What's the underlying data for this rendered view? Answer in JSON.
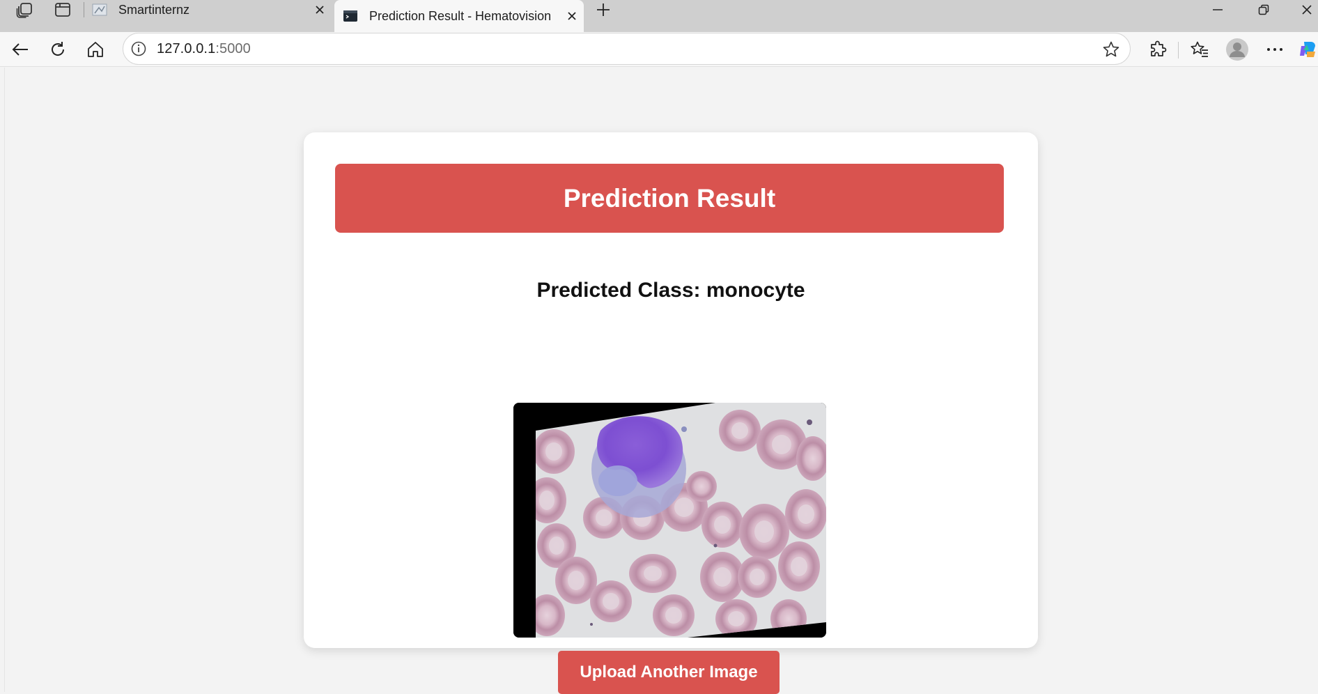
{
  "browser": {
    "tabs": [
      {
        "title": "Smartinternz",
        "active": false,
        "favicon": "page-favicon"
      },
      {
        "title": "Prediction Result - Hematovision",
        "active": true,
        "favicon": "terminal-favicon"
      }
    ],
    "address": {
      "host": "127.0.0.1",
      "port": ":5000"
    }
  },
  "page": {
    "banner_title": "Prediction Result",
    "predicted_label": "Predicted Class: monocyte",
    "image_alt": "blood-smear-image",
    "upload_button": "Upload Another Image"
  },
  "colors": {
    "accent": "#d9534f",
    "page_background": "#f3f3f3",
    "card_background": "#ffffff"
  }
}
